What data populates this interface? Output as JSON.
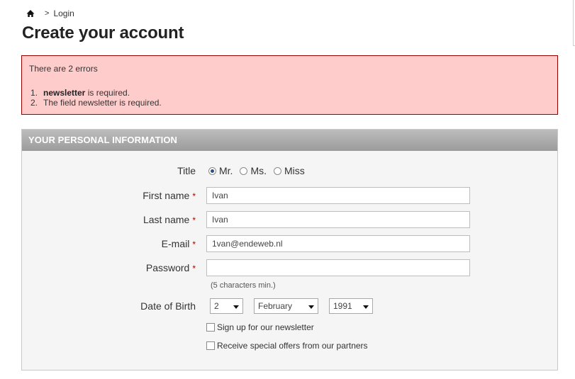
{
  "breadcrumb": {
    "home_icon": "home-icon",
    "separator": ">",
    "current": "Login"
  },
  "page_title": "Create your account",
  "errors": {
    "title": "There are 2 errors",
    "items": [
      {
        "num": "1.",
        "bold": "newsletter",
        "text": " is required."
      },
      {
        "num": "2.",
        "bold": "",
        "text": "The field newsletter is required."
      }
    ]
  },
  "form": {
    "section_title": "YOUR PERSONAL INFORMATION",
    "required_mark": "*",
    "title_label": "Title",
    "title_options": [
      {
        "label": "Mr.",
        "checked": true
      },
      {
        "label": "Ms.",
        "checked": false
      },
      {
        "label": "Miss",
        "checked": false
      }
    ],
    "first_name_label": "First name",
    "first_name_value": "Ivan",
    "last_name_label": "Last name",
    "last_name_value": "Ivan",
    "email_label": "E-mail",
    "email_value": "1van@endeweb.nl",
    "password_label": "Password",
    "password_value": "",
    "password_hint": "(5 characters min.)",
    "dob_label": "Date of Birth",
    "dob_day": "2",
    "dob_month": "February",
    "dob_year": "1991",
    "newsletter_label": "Sign up for our newsletter",
    "newsletter_checked": false,
    "offers_label": "Receive special offers from our partners",
    "offers_checked": false
  },
  "colors": {
    "error_bg": "#ffcccc",
    "error_border": "#990000",
    "required": "#990000",
    "header_gradient_top": "#bdbdbd",
    "header_gradient_bottom": "#9b9b9b"
  }
}
